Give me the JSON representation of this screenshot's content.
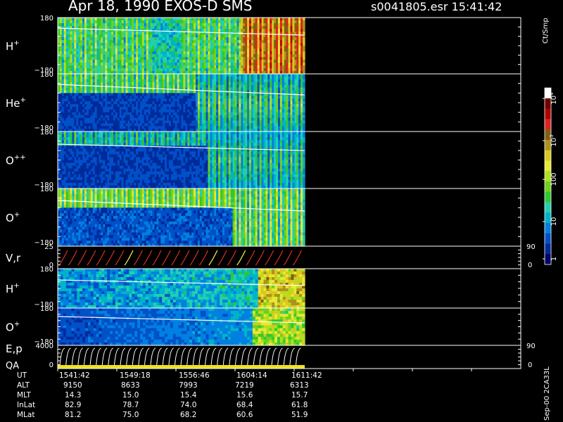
{
  "header": {
    "title": "Apr 18, 1990   EXOS-D SMS",
    "file": "s0041805.esr  15:41:42"
  },
  "panels": [
    {
      "label": "H",
      "sup": "+",
      "ymax": "180",
      "ymin": "−180"
    },
    {
      "label": "He",
      "sup": "+",
      "ymax": "180",
      "ymin": "−180"
    },
    {
      "label": "O",
      "sup": "++",
      "ymax": "180",
      "ymin": "−180"
    },
    {
      "label": "O",
      "sup": "+",
      "ymax": "180",
      "ymin": "−180"
    },
    {
      "label": "V,r",
      "sup": "",
      "ymax": "25",
      "ymin": "0",
      "rmax": "90",
      "rmin": "0"
    },
    {
      "label": "H",
      "sup": "+",
      "ymax": "180",
      "ymin": "−180"
    },
    {
      "label": "O",
      "sup": "+",
      "ymax": "180",
      "ymin": "−180"
    },
    {
      "label": "E,p",
      "sup": "",
      "ymax": "4000",
      "ymin": "0",
      "rmax": "90",
      "rmin": "0"
    }
  ],
  "qa_label": "QA",
  "colorbar": {
    "unit": "Ct/Smp",
    "ticks": [
      "10^4",
      "10^3",
      "100",
      "10",
      "1"
    ]
  },
  "footer": {
    "rows": [
      {
        "label": "UT",
        "values": [
          "1541:42",
          "1549:18",
          "1556:46",
          "1604:14",
          "1611:42"
        ]
      },
      {
        "label": "ALT",
        "values": [
          "9150",
          "8633",
          "7993",
          "7219",
          "6313"
        ]
      },
      {
        "label": "MLT",
        "values": [
          "14.3",
          "15.0",
          "15.4",
          "15.6",
          "15.7"
        ]
      },
      {
        "label": "InLat",
        "values": [
          "82.9",
          "78.7",
          "74.0",
          "68.4",
          "61.8"
        ]
      },
      {
        "label": "MLat",
        "values": [
          "81.2",
          "75.0",
          "68.2",
          "60.6",
          "51.9"
        ]
      }
    ]
  },
  "credit": "Sep-00  2CA33L",
  "colors": {
    "background": "#000000",
    "axis": "#ffffff",
    "colorbar": [
      "#000066",
      "#002a9a",
      "#0050c8",
      "#0080e0",
      "#00b4c8",
      "#20d0b0",
      "#30c830",
      "#70d020",
      "#b0e020",
      "#e8e830",
      "#d8c820",
      "#b09020",
      "#806010",
      "#e02020",
      "#b00000",
      "#700000",
      "#ffffff"
    ]
  },
  "chart_data": {
    "type": "heatmap",
    "title": "Apr 18, 1990   EXOS-D SMS",
    "x_ticks": [
      "1541:42",
      "1549:18",
      "1556:46",
      "1604:14",
      "1611:42"
    ],
    "series": [
      {
        "name": "H+",
        "ylim": [
          -180,
          180
        ]
      },
      {
        "name": "He+",
        "ylim": [
          -180,
          180
        ]
      },
      {
        "name": "O++",
        "ylim": [
          -180,
          180
        ]
      },
      {
        "name": "O+",
        "ylim": [
          -180,
          180
        ]
      },
      {
        "name": "V,r",
        "ylim": [
          0,
          25
        ],
        "y2lim": [
          0,
          90
        ]
      },
      {
        "name": "H+",
        "ylim": [
          -180,
          180
        ]
      },
      {
        "name": "O+",
        "ylim": [
          -180,
          180
        ]
      },
      {
        "name": "E,p",
        "ylim": [
          0,
          4000
        ],
        "y2lim": [
          0,
          90
        ]
      }
    ],
    "colorbar": {
      "label": "Ct/Smp",
      "scale": "log",
      "range": [
        1,
        10000
      ],
      "ticks": [
        "1",
        "10",
        "100",
        "10^3",
        "10^4"
      ]
    }
  }
}
